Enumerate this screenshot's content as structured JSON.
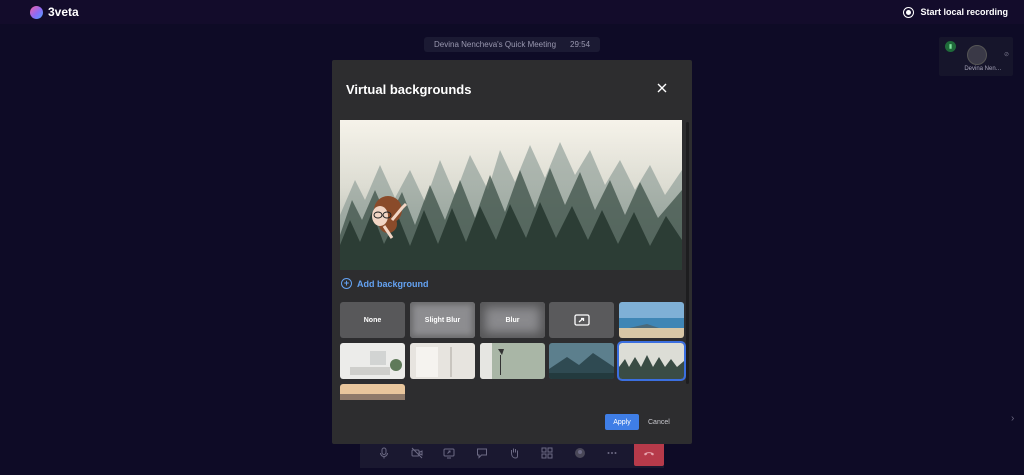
{
  "app": {
    "name": "3veta"
  },
  "topbar": {
    "record_label": "Start local recording"
  },
  "meeting": {
    "title": "Devina Nencheva's Quick Meeting",
    "timer": "29:54"
  },
  "participant": {
    "name": "Devina Nen…"
  },
  "modal": {
    "title": "Virtual backgrounds",
    "add_background": "Add background",
    "options": [
      {
        "label": "None"
      },
      {
        "label": "Slight Blur"
      },
      {
        "label": "Blur"
      }
    ],
    "apply": "Apply",
    "cancel": "Cancel"
  },
  "colors": {
    "accent": "#3f7ee6",
    "link": "#64a2f2",
    "hangup": "#b63a4a",
    "modal_bg": "#2d2d2f",
    "page_bg": "#0e0b26"
  },
  "icons": [
    "logo-icon",
    "record-icon",
    "close-icon",
    "add-circle-icon",
    "share-screen-icon",
    "microphone-icon",
    "camera-off-icon",
    "screen-share-icon",
    "chat-icon",
    "raise-hand-icon",
    "grid-icon",
    "avatar-icon",
    "more-icon",
    "hangup-icon",
    "chevron-right-icon"
  ]
}
